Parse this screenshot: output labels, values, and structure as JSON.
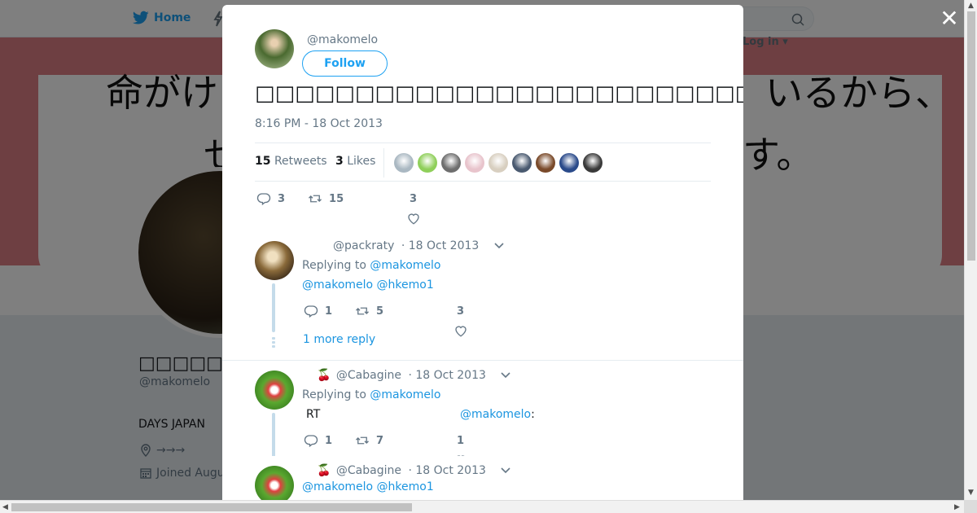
{
  "background": {
    "nav": {
      "home_label": "Home",
      "login_label": "Log in ▾"
    },
    "banner": {
      "text_line1_left": "命がけ",
      "text_line1_right": "いるから、",
      "text_line2_left": "せ",
      "text_line2_right": "す。"
    },
    "profile": {
      "name": "□□□□□□",
      "handle": "@makomelo",
      "bio": "DAYS JAPAN",
      "location": "→→→",
      "joined": "Joined Augu"
    }
  },
  "modal": {
    "close_label": "✕",
    "author_handle": "@makomelo",
    "follow_label": "Follow",
    "tweet_text": "□□□□□□□□□□□□□□□□□□□□□□□□□□□□□□□□□□□□□□□□□□□□□□□□□□□□□□□□□□□□□□□□□□□□□□□□□□□□□□□□□□",
    "timestamp": "8:16 PM - 18 Oct 2013",
    "retweets_count": "15",
    "retweets_label": "Retweets",
    "likes_count": "3",
    "likes_label": "Likes",
    "actions": {
      "replies": "3",
      "retweets": "15",
      "likes": "3"
    },
    "liker_colors": [
      "#aab8c2",
      "#8fcf5a",
      "#6e6e6e",
      "#e8c4cc",
      "#d8cfc0",
      "#4a5a70",
      "#7a4a2a",
      "#2a4a8a",
      "#3a3a3a"
    ]
  },
  "replies": [
    {
      "handle": "@packraty",
      "date": "· 18 Oct 2013",
      "replying_prefix": "Replying to",
      "replying_to": "@makomelo",
      "body_mentions": "@makomelo @hkemo1",
      "actions": {
        "replies": "1",
        "retweets": "5",
        "likes": "3"
      },
      "more_reply": "1 more reply"
    },
    {
      "emoji": "🍒",
      "handle": "@Cabagine",
      "date": "· 18 Oct 2013",
      "replying_prefix": "Replying to",
      "replying_to": "@makomelo",
      "body_text": "RT",
      "body_mention": "@makomelo",
      "body_suffix": ":",
      "actions": {
        "replies": "1",
        "retweets": "7",
        "likes": "1"
      }
    },
    {
      "emoji": "🍒",
      "handle": "@Cabagine",
      "date": "· 18 Oct 2013",
      "body_mentions": "@makomelo @hkemo1"
    }
  ]
}
